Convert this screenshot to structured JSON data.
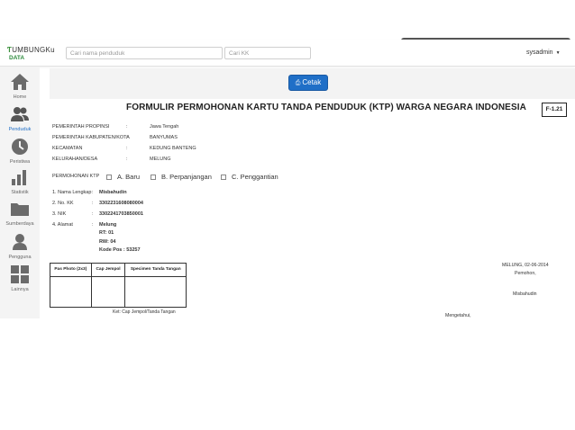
{
  "header": {
    "logo_text_1": "UMBUNGKu",
    "logo_text_2": "DATA",
    "search_name_placeholder": "Cari nama penduduk",
    "search_kk_placeholder": "Cari KK",
    "user": "sysadmin",
    "caret": "▼"
  },
  "sidebar": {
    "items": [
      {
        "label": "Home",
        "icon": "home-icon"
      },
      {
        "label": "Penduduk",
        "icon": "users-icon"
      },
      {
        "label": "Peristiwa",
        "icon": "clock-icon"
      },
      {
        "label": "Statistik",
        "icon": "bar-chart-icon"
      },
      {
        "label": "Sumberdaya",
        "icon": "folder-icon"
      },
      {
        "label": "Pengguna",
        "icon": "user-icon"
      },
      {
        "label": "Lainnya",
        "icon": "grid-icon"
      }
    ],
    "active_index": 1,
    "active_color": "#1f6fc7"
  },
  "actions": {
    "print_label": "Cetak",
    "print_icon": "printer-icon",
    "button_color": "#1f6fc7"
  },
  "form": {
    "title": "FORMULIR PERMOHONAN KARTU TANDA PENDUDUK (KTP) WARGA NEGARA INDONESIA",
    "code": "F-1.21",
    "separator": ":",
    "region": [
      {
        "label": "PEMERINTAH PROPINSI",
        "value": "Jawa Tengah"
      },
      {
        "label": "PEMERINTAH KABUPATEN/KOTA",
        "value": "BANYUMAS"
      },
      {
        "label": "KECAMATAN",
        "value": "KEDUNG BANTENG"
      },
      {
        "label": "KELURAHAN/DESA",
        "value": "MELUNG"
      }
    ],
    "ktp_label": "PERMOHONAN KTP",
    "ktp_options": [
      "A. Baru",
      "B. Perpanjangan",
      "C. Penggantian"
    ],
    "fields": [
      {
        "label": "1. Nama Lengkap",
        "value": "Misbahudin"
      },
      {
        "label": "2. No. KK",
        "value": "3302231608080004"
      },
      {
        "label": "3. NIK",
        "value": "3302241703850001"
      },
      {
        "label": "4. Alamat",
        "value": "Melung"
      }
    ],
    "address_extra": [
      "RT: 01",
      "RW: 04",
      "Kode Pos : 53257"
    ],
    "photo_table": {
      "headers": [
        "Pas Photo (2x3)",
        "Cap Jempol",
        "Specimen Tanda Tangan"
      ]
    },
    "photo_note": "Ket: Cap Jempol/Tanda Tangan",
    "place_date": "MELUNG, 02-06-2014",
    "applicant_label": "Pemohon,",
    "applicant_name": "Misbahudin",
    "approval_label": "Mengetahui,"
  }
}
